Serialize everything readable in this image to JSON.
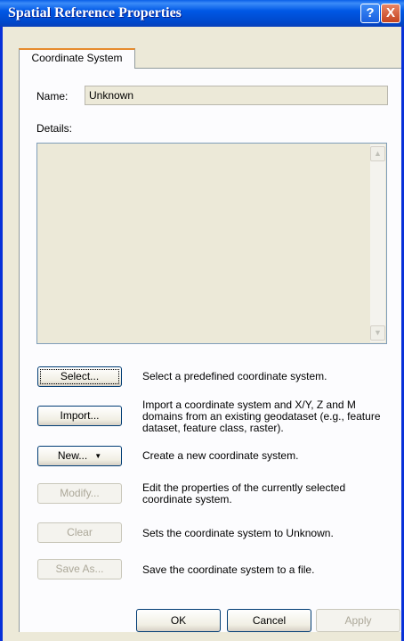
{
  "window": {
    "title": "Spatial Reference Properties",
    "help_symbol": "?",
    "close_symbol": "X"
  },
  "tabs": [
    {
      "label": "Coordinate System"
    }
  ],
  "name": {
    "label": "Name:",
    "value": "Unknown"
  },
  "details": {
    "label": "Details:",
    "value": ""
  },
  "actions": [
    {
      "label": "Select...",
      "description": "Select a predefined coordinate system.",
      "enabled": true
    },
    {
      "label": "Import...",
      "description": "Import a coordinate system and X/Y, Z and M domains from an existing geodataset (e.g., feature dataset, feature class, raster).",
      "enabled": true
    },
    {
      "label": "New...",
      "description": "Create a new coordinate system.",
      "enabled": true
    },
    {
      "label": "Modify...",
      "description": "Edit the properties of the currently selected coordinate system.",
      "enabled": false
    },
    {
      "label": "Clear",
      "description": "Sets the coordinate system to Unknown.",
      "enabled": false
    },
    {
      "label": "Save As...",
      "description": "Save the coordinate system to a file.",
      "enabled": false
    }
  ],
  "footer": {
    "ok_label": "OK",
    "cancel_label": "Cancel",
    "apply_label": "Apply"
  },
  "colors": {
    "titlebar": "#0058e6",
    "face": "#ece9d8",
    "disabled_text": "#aca899"
  }
}
